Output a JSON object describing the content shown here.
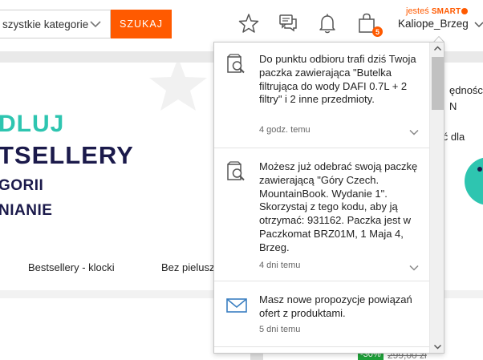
{
  "header": {
    "category_select": "szystkie kategorie",
    "search_button": "SZUKAJ",
    "smart_prefix": "jesteś",
    "smart_label": "SMART",
    "username": "Kaliope_Brzeg",
    "cart_count": "5",
    "icons": [
      "star-icon",
      "chat-icon",
      "bell-icon",
      "cart-bag-icon"
    ]
  },
  "banner": {
    "line1": "DLUJ",
    "line2": "TSELLERY",
    "line3": "GORII",
    "line4": "NIANIE",
    "right_text_a": "ędności",
    "right_text_b": "N",
    "right_text_c": "ość dla"
  },
  "tabs": [
    "Bestsellery - klocki",
    "Bez pielusz"
  ],
  "lower": {
    "discount": "-30%",
    "old_price": "299,00 zł"
  },
  "notifications": [
    {
      "icon": "package-search-icon",
      "text": "Do punktu odbioru trafi dziś Twoja paczka zawierająca \"Butelka filtrująca do wody DAFI 0.7L + 2 filtry\" i 2 inne przedmioty.",
      "time": "4 godz. temu"
    },
    {
      "icon": "package-search-icon",
      "text": "Możesz już odebrać swoją paczkę zawierającą \"Góry Czech. MountainBook. Wydanie 1\". Skorzystaj z tego kodu, aby ją otrzymać: 931162. Paczka jest w Paczkomat BRZ01M, 1 Maja 4, Brzeg.",
      "time": "4 dni temu"
    },
    {
      "icon": "envelope-icon",
      "text": "Masz nowe propozycje powiązań ofert z produktami.",
      "time": "5 dni temu"
    }
  ],
  "colors": {
    "accent": "#ff5a00",
    "teal": "#2ec5b0",
    "navy": "#1b1a4b",
    "icon_blue": "#3a7fc1"
  }
}
